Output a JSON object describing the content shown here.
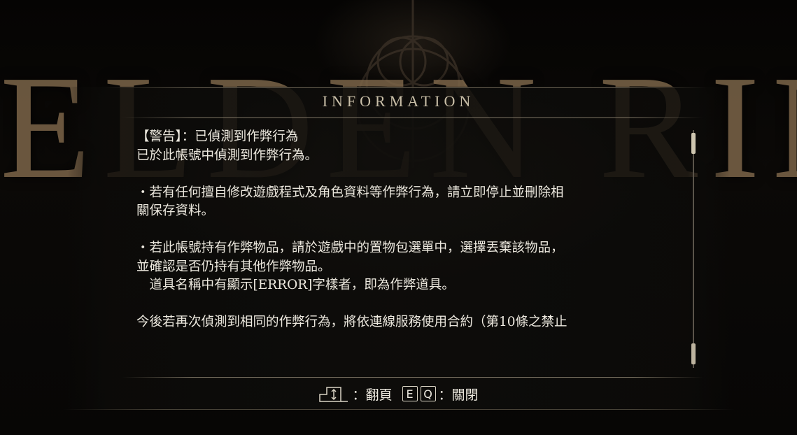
{
  "background": {
    "logo_text": "ELDEN RING"
  },
  "dialog": {
    "title": "INFORMATION",
    "lines": [
      "【警告】：已偵測到作弊行為",
      "已於此帳號中偵測到作弊行為。",
      "",
      "・若有任何擅自修改遊戲程式及角色資料等作弊行為，請立即停止並刪除相",
      "關保存資料。",
      "",
      "・若此帳號持有作弊物品，請於遊戲中的置物包選單中，選擇丟棄該物品，",
      "並確認是否仍持有其他作弊物品。",
      "　道具名稱中有顯示[ERROR]字樣者，即為作弊道具。",
      "",
      "今後若再次偵測到相同的作弊行為，將依連線服務使用合約（第10條之禁止"
    ],
    "scrollbar": {
      "visible": true
    }
  },
  "footer": {
    "page_icon": "up-down-arrows-icon",
    "page_label": "：翻頁",
    "close_key_1": "E",
    "close_key_2": "Q",
    "close_label": "：關閉"
  },
  "colors": {
    "text": "#ece8de",
    "title": "#c9bfa8",
    "panel": "#0e0d0b",
    "logo": "#5d4b37"
  }
}
